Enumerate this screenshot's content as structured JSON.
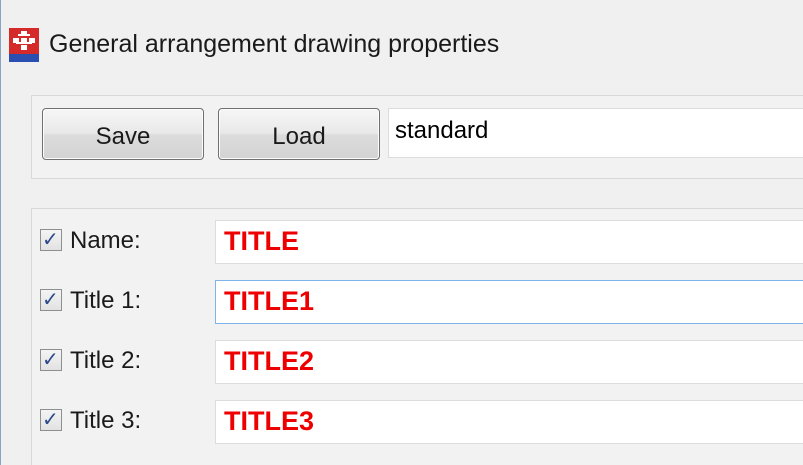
{
  "window": {
    "title": "General arrangement drawing properties",
    "icon": "app-logo-icon",
    "accent_color": "#ee0000"
  },
  "toolbar": {
    "save_label": "Save",
    "load_label": "Load",
    "preset_value": "standard"
  },
  "fields": [
    {
      "label": "Name:",
      "value": "TITLE",
      "checked": true
    },
    {
      "label": "Title 1:",
      "value": "TITLE1",
      "checked": true
    },
    {
      "label": "Title 2:",
      "value": "TITLE2",
      "checked": true
    },
    {
      "label": "Title 3:",
      "value": "TITLE3",
      "checked": true
    }
  ],
  "icons": {
    "checkmark": "✓"
  }
}
